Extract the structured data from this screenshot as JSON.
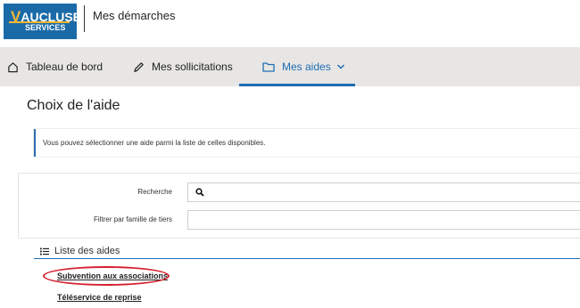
{
  "header": {
    "logo_top": "AUCLUSE",
    "logo_v": "V",
    "logo_bottom": "SERVICES",
    "app_title": "Mes démarches",
    "brand_color": "#1a6aa8",
    "accent_color": "#f3b731"
  },
  "nav": {
    "items": [
      {
        "label": "Tableau de bord",
        "icon": "home-icon"
      },
      {
        "label": "Mes sollicitations",
        "icon": "pen-icon"
      },
      {
        "label": "Mes aides",
        "icon": "folder-icon",
        "active": true,
        "trailing_icon": "chevron-down-icon"
      }
    ],
    "active_color": "#1f6db3"
  },
  "page": {
    "title": "Choix de l'aide",
    "info_text": "Vous pouvez sélectionner une aide parmi la liste de celles disponibles."
  },
  "form": {
    "search_label": "Recherche",
    "search_value": "",
    "filter_label": "Filtrer par famille de tiers",
    "filter_value": ""
  },
  "list": {
    "heading": "Liste des aides",
    "items": [
      {
        "label": "Subvention aux associations",
        "highlighted": true
      },
      {
        "label": "Téléservice de reprise"
      }
    ],
    "highlight_color": "#d5202f"
  }
}
